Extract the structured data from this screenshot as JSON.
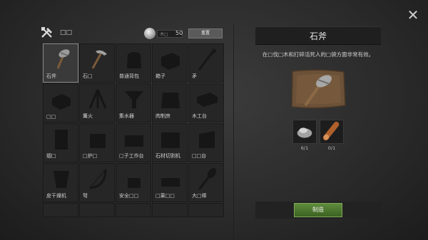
{
  "header": {
    "title": "□□",
    "resource_label": "木□",
    "resource_count": "50",
    "resource_button": "重置"
  },
  "grid": {
    "items": [
      {
        "label": "石斧",
        "icon": "stone-axe-icon",
        "selected": true
      },
      {
        "label": "石□",
        "icon": "stone-pickaxe-icon",
        "selected": false
      },
      {
        "label": "普通背包",
        "icon": "backpack-icon",
        "selected": false
      },
      {
        "label": "箱子",
        "icon": "chest-icon",
        "selected": false
      },
      {
        "label": "矛",
        "icon": "spear-icon",
        "selected": false
      },
      {
        "label": "□□",
        "icon": "locked-item-icon",
        "selected": false
      },
      {
        "label": "篝火",
        "icon": "campfire-icon",
        "selected": false
      },
      {
        "label": "集水器",
        "icon": "water-collector-icon",
        "selected": false
      },
      {
        "label": "肉制房",
        "icon": "meat-dryer-icon",
        "selected": false
      },
      {
        "label": "木工台",
        "icon": "workbench-icon",
        "selected": false
      },
      {
        "label": "烟□",
        "icon": "locked-item-icon",
        "selected": false
      },
      {
        "label": "□炉□",
        "icon": "furnace-icon",
        "selected": false
      },
      {
        "label": "□子工作台",
        "icon": "workbench-icon",
        "selected": false
      },
      {
        "label": "石材切割机",
        "icon": "stone-cutter-icon",
        "selected": false
      },
      {
        "label": "□□台",
        "icon": "locked-item-icon",
        "selected": false
      },
      {
        "label": "皮干燥机",
        "icon": "hide-dryer-icon",
        "selected": false
      },
      {
        "label": "弩",
        "icon": "bow-icon",
        "selected": false
      },
      {
        "label": "安全□□",
        "icon": "locked-item-icon",
        "selected": false
      },
      {
        "label": "□果□□",
        "icon": "locked-item-icon",
        "selected": false
      },
      {
        "label": "大□棒",
        "icon": "club-icon",
        "selected": false
      }
    ]
  },
  "detail": {
    "title": "石斧",
    "description": "在□伐□木和打碎活死人的□袋方面非常有效。",
    "ingredients": [
      {
        "name": "stone",
        "icon": "stone-icon",
        "count": "6/1"
      },
      {
        "name": "log",
        "icon": "log-icon",
        "count": "0/1"
      }
    ],
    "craft_button": "制造"
  },
  "colors": {
    "accent_green": "#4e7a30",
    "panel_dark": "#262626"
  }
}
